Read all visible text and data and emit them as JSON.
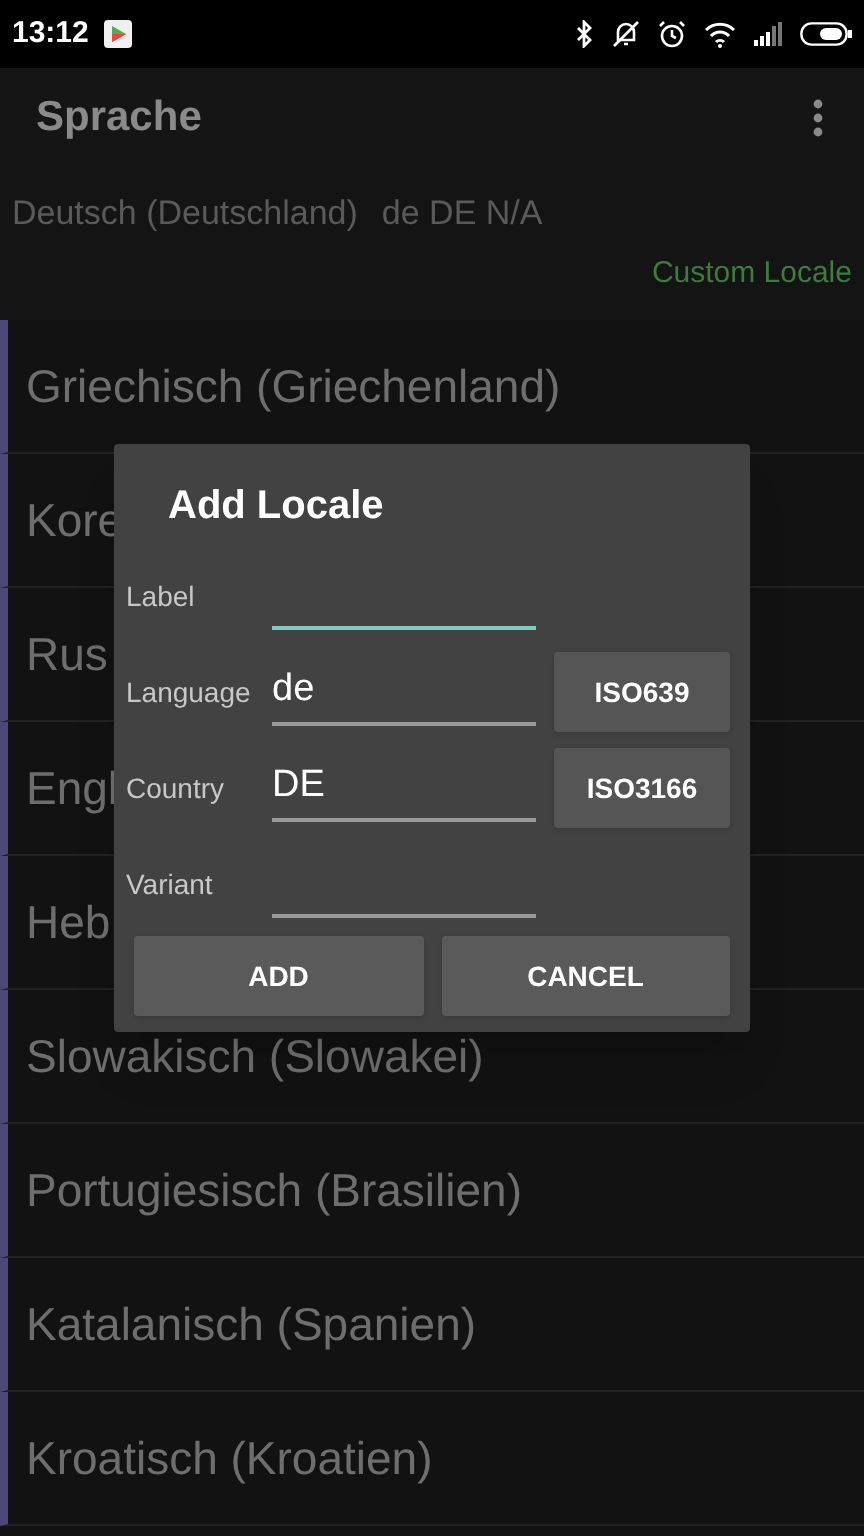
{
  "status_bar": {
    "time": "13:12"
  },
  "app_bar": {
    "title": "Sprache"
  },
  "current": {
    "name": "Deutsch (Deutschland)",
    "code": "de DE N/A",
    "custom_label": "Custom Locale"
  },
  "locales": [
    {
      "label": "Griechisch (Griechenland)"
    },
    {
      "label": "Kore"
    },
    {
      "label": "Rus"
    },
    {
      "label": "Engl"
    },
    {
      "label": "Heb"
    },
    {
      "label": "Slowakisch (Slowakei)"
    },
    {
      "label": "Portugiesisch (Brasilien)"
    },
    {
      "label": "Katalanisch (Spanien)"
    },
    {
      "label": "Kroatisch (Kroatien)"
    }
  ],
  "dialog": {
    "title": "Add Locale",
    "fields": [
      {
        "label": "Label",
        "focused": true
      },
      {
        "label": "Language",
        "value": "de",
        "focused": false,
        "button": "ISO639"
      },
      {
        "label": "Country",
        "value": "DE",
        "focused": false,
        "button": "ISO3166"
      },
      {
        "label": "Variant",
        "focused": false
      }
    ],
    "buttons": [
      "ADD",
      "CANCEL"
    ]
  }
}
